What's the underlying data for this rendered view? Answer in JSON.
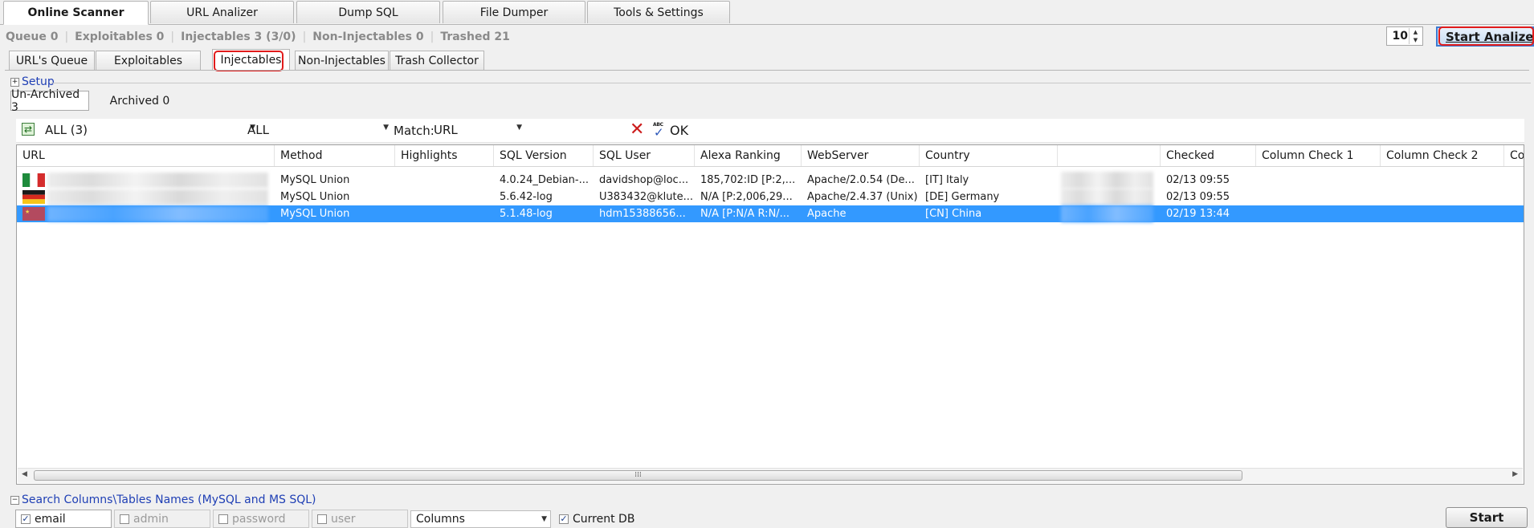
{
  "main_tabs": [
    {
      "label": "Online Scanner",
      "active": true
    },
    {
      "label": "URL Analizer",
      "active": false
    },
    {
      "label": "Dump SQL",
      "active": false
    },
    {
      "label": "File Dumper",
      "active": false
    },
    {
      "label": "Tools & Settings",
      "active": false
    }
  ],
  "status": {
    "queue": "Queue 0",
    "exploitables": "Exploitables 0",
    "injectables": "Injectables 3 (3/0)",
    "non_injectables": "Non-Injectables 0",
    "trashed": "Trashed 21"
  },
  "threads": {
    "value": "10"
  },
  "start_analizer": {
    "label": "Start Analizer"
  },
  "sub_tabs": [
    {
      "label": "URL's Queue",
      "active": false
    },
    {
      "label": "Exploitables",
      "active": false
    },
    {
      "label": "Injectables",
      "active": true
    },
    {
      "label": "Non-Injectables",
      "active": false
    },
    {
      "label": "Trash Collector",
      "active": false
    }
  ],
  "setup": {
    "label": "Setup",
    "expander": "+"
  },
  "archive_tabs": [
    {
      "label": "Un-Archived 3",
      "active": true
    },
    {
      "label": "Archived 0",
      "active": false
    }
  ],
  "filter": {
    "country": "ALL (3)",
    "method": "ALL",
    "match_label": "Match:",
    "match_field": "URL",
    "ok_label": "OK"
  },
  "grid": {
    "columns": [
      "URL",
      "Method",
      "Highlights",
      "SQL Version",
      "SQL User",
      "Alexa Ranking",
      "WebServer",
      "Country",
      "",
      "Checked",
      "Column Check 1",
      "Column Check 2",
      "Co"
    ],
    "rows": [
      {
        "flag": "it",
        "method": "MySQL Union",
        "highlights": "",
        "sql_version": "4.0.24_Debian-...",
        "sql_user": "davidshop@loc...",
        "alexa": "185,702:ID [P:2,...",
        "webserver": "Apache/2.0.54 (De...",
        "country": "[IT] Italy",
        "checked": "02/13 09:55",
        "selected": false
      },
      {
        "flag": "de",
        "method": "MySQL Union",
        "highlights": "",
        "sql_version": "5.6.42-log",
        "sql_user": "U383432@klute...",
        "alexa": "N/A [P:2,006,29...",
        "webserver": "Apache/2.4.37 (Unix)",
        "country": "[DE] Germany",
        "checked": "02/13 09:55",
        "selected": false
      },
      {
        "flag": "cn",
        "method": "MySQL Union",
        "highlights": "",
        "sql_version": "5.1.48-log",
        "sql_user": "hdm15388656...",
        "alexa": "N/A [P:N/A R:N/...",
        "webserver": "Apache",
        "country": "[CN] China",
        "checked": "02/19 13:44",
        "selected": true
      }
    ],
    "scroll_grip": "⁞⁞⁞"
  },
  "search_panel": {
    "title": "Search Columns\\Tables Names (MySQL and MS SQL)",
    "expander": "−",
    "terms": [
      {
        "label": "email",
        "checked": true,
        "enabled": true
      },
      {
        "label": "admin",
        "checked": false,
        "enabled": false
      },
      {
        "label": "password",
        "checked": false,
        "enabled": false
      },
      {
        "label": "user",
        "checked": false,
        "enabled": false
      }
    ],
    "mode": "Columns",
    "current_db_label": "Current DB",
    "current_db_checked": true,
    "start_label": "Start"
  },
  "colors": {
    "selection": "#3399ff",
    "link_blue": "#1f3fb5",
    "highlight_ring": "#e11b1b",
    "start_analizer_border": "#3b7bd3"
  }
}
